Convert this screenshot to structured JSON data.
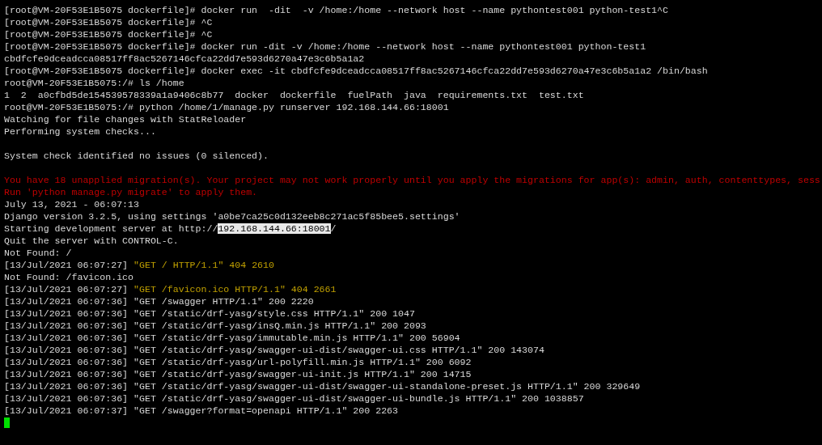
{
  "terminal": {
    "lines": [
      {
        "kind": "text",
        "segments": [
          {
            "kind": "normal",
            "text": "[root@VM-20F53E1B5075 dockerfile]# docker run  -dit  -v /home:/home --network host --name pythontest001 python-test1^C"
          }
        ]
      },
      {
        "kind": "text",
        "segments": [
          {
            "kind": "normal",
            "text": "[root@VM-20F53E1B5075 dockerfile]# ^C"
          }
        ]
      },
      {
        "kind": "text",
        "segments": [
          {
            "kind": "normal",
            "text": "[root@VM-20F53E1B5075 dockerfile]# ^C"
          }
        ]
      },
      {
        "kind": "text",
        "segments": [
          {
            "kind": "normal",
            "text": "[root@VM-20F53E1B5075 dockerfile]# docker run -dit -v /home:/home --network host --name pythontest001 python-test1"
          }
        ]
      },
      {
        "kind": "text",
        "segments": [
          {
            "kind": "normal",
            "text": "cbdfcfe9dceadcca08517ff8ac5267146cfca22dd7e593d6270a47e3c6b5a1a2"
          }
        ]
      },
      {
        "kind": "text",
        "segments": [
          {
            "kind": "normal",
            "text": "[root@VM-20F53E1B5075 dockerfile]# docker exec -it cbdfcfe9dceadcca08517ff8ac5267146cfca22dd7e593d6270a47e3c6b5a1a2 /bin/bash"
          }
        ]
      },
      {
        "kind": "text",
        "segments": [
          {
            "kind": "normal",
            "text": "root@VM-20F53E1B5075:/# ls /home"
          }
        ]
      },
      {
        "kind": "text",
        "segments": [
          {
            "kind": "normal",
            "text": "1  2  a0cfbd5de154539578339a1a9406c8b77  docker  dockerfile  fuelPath  java  requirements.txt  test.txt"
          }
        ]
      },
      {
        "kind": "text",
        "segments": [
          {
            "kind": "normal",
            "text": "root@VM-20F53E1B5075:/# python /home/1/manage.py runserver 192.168.144.66:18001"
          }
        ]
      },
      {
        "kind": "text",
        "segments": [
          {
            "kind": "normal",
            "text": "Watching for file changes with StatReloader"
          }
        ]
      },
      {
        "kind": "text",
        "segments": [
          {
            "kind": "normal",
            "text": "Performing system checks..."
          }
        ]
      },
      {
        "kind": "blank"
      },
      {
        "kind": "text",
        "segments": [
          {
            "kind": "normal",
            "text": "System check identified no issues (0 silenced)."
          }
        ]
      },
      {
        "kind": "blank"
      },
      {
        "kind": "text",
        "segments": [
          {
            "kind": "error",
            "text": "You have 18 unapplied migration(s). Your project may not work properly until you apply the migrations for app(s): admin, auth, contenttypes, sess"
          }
        ]
      },
      {
        "kind": "text",
        "segments": [
          {
            "kind": "error",
            "text": "Run 'python manage.py migrate' to apply them."
          }
        ]
      },
      {
        "kind": "text",
        "segments": [
          {
            "kind": "normal",
            "text": "July 13, 2021 - 06:07:13"
          }
        ]
      },
      {
        "kind": "text",
        "segments": [
          {
            "kind": "normal",
            "text": "Django version 3.2.5, using settings 'a0be7ca25c0d132eeb8c271ac5f85bee5.settings'"
          }
        ]
      },
      {
        "kind": "text",
        "segments": [
          {
            "kind": "normal",
            "text": "Starting development server at http://"
          },
          {
            "kind": "selection",
            "text": "192.168.144.66:18001"
          },
          {
            "kind": "normal",
            "text": "/"
          }
        ]
      },
      {
        "kind": "text",
        "segments": [
          {
            "kind": "normal",
            "text": "Quit the server with CONTROL-C."
          }
        ]
      },
      {
        "kind": "text",
        "segments": [
          {
            "kind": "normal",
            "text": "Not Found: /"
          }
        ]
      },
      {
        "kind": "text",
        "segments": [
          {
            "kind": "normal",
            "text": "[13/Jul/2021 06:07:27] "
          },
          {
            "kind": "warning",
            "text": "\"GET / HTTP/1.1\" 404 2610"
          }
        ]
      },
      {
        "kind": "text",
        "segments": [
          {
            "kind": "normal",
            "text": "Not Found: /favicon.ico"
          }
        ]
      },
      {
        "kind": "text",
        "segments": [
          {
            "kind": "normal",
            "text": "[13/Jul/2021 06:07:27] "
          },
          {
            "kind": "warning",
            "text": "\"GET /favicon.ico HTTP/1.1\" 404 2661"
          }
        ]
      },
      {
        "kind": "text",
        "segments": [
          {
            "kind": "normal",
            "text": "[13/Jul/2021 06:07:36] \"GET /swagger HTTP/1.1\" 200 2220"
          }
        ]
      },
      {
        "kind": "text",
        "segments": [
          {
            "kind": "normal",
            "text": "[13/Jul/2021 06:07:36] \"GET /static/drf-yasg/style.css HTTP/1.1\" 200 1047"
          }
        ]
      },
      {
        "kind": "text",
        "segments": [
          {
            "kind": "normal",
            "text": "[13/Jul/2021 06:07:36] \"GET /static/drf-yasg/insQ.min.js HTTP/1.1\" 200 2093"
          }
        ]
      },
      {
        "kind": "text",
        "segments": [
          {
            "kind": "normal",
            "text": "[13/Jul/2021 06:07:36] \"GET /static/drf-yasg/immutable.min.js HTTP/1.1\" 200 56904"
          }
        ]
      },
      {
        "kind": "text",
        "segments": [
          {
            "kind": "normal",
            "text": "[13/Jul/2021 06:07:36] \"GET /static/drf-yasg/swagger-ui-dist/swagger-ui.css HTTP/1.1\" 200 143074"
          }
        ]
      },
      {
        "kind": "text",
        "segments": [
          {
            "kind": "normal",
            "text": "[13/Jul/2021 06:07:36] \"GET /static/drf-yasg/url-polyfill.min.js HTTP/1.1\" 200 6092"
          }
        ]
      },
      {
        "kind": "text",
        "segments": [
          {
            "kind": "normal",
            "text": "[13/Jul/2021 06:07:36] \"GET /static/drf-yasg/swagger-ui-init.js HTTP/1.1\" 200 14715"
          }
        ]
      },
      {
        "kind": "text",
        "segments": [
          {
            "kind": "normal",
            "text": "[13/Jul/2021 06:07:36] \"GET /static/drf-yasg/swagger-ui-dist/swagger-ui-standalone-preset.js HTTP/1.1\" 200 329649"
          }
        ]
      },
      {
        "kind": "text",
        "segments": [
          {
            "kind": "normal",
            "text": "[13/Jul/2021 06:07:36] \"GET /static/drf-yasg/swagger-ui-dist/swagger-ui-bundle.js HTTP/1.1\" 200 1038857"
          }
        ]
      },
      {
        "kind": "text",
        "segments": [
          {
            "kind": "normal",
            "text": "[13/Jul/2021 06:07:37] \"GET /swagger?format=openapi HTTP/1.1\" 200 2263"
          }
        ]
      },
      {
        "kind": "cursor"
      }
    ]
  }
}
